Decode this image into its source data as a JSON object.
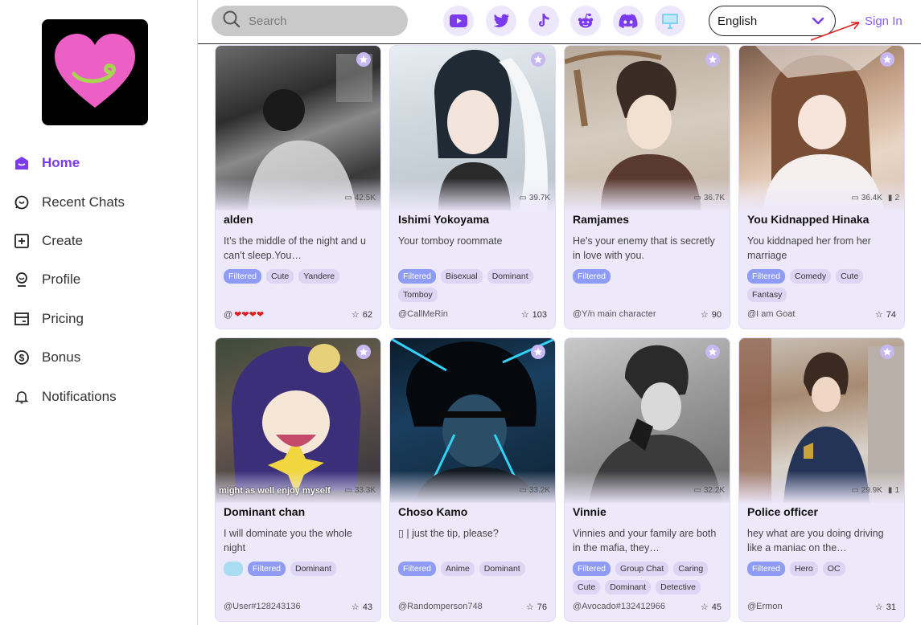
{
  "sidebar": {
    "items": [
      {
        "label": "Home",
        "icon": "home-icon",
        "active": true
      },
      {
        "label": "Recent Chats",
        "icon": "chat-icon"
      },
      {
        "label": "Create",
        "icon": "plus-square-icon"
      },
      {
        "label": "Profile",
        "icon": "user-icon"
      },
      {
        "label": "Pricing",
        "icon": "card-icon"
      },
      {
        "label": "Bonus",
        "icon": "dollar-icon"
      },
      {
        "label": "Notifications",
        "icon": "bell-icon"
      }
    ]
  },
  "topbar": {
    "search_placeholder": "Search",
    "social": [
      "youtube-icon",
      "twitter-icon",
      "tiktok-icon",
      "reddit-icon",
      "discord-icon",
      "desktop-icon"
    ],
    "language": "English",
    "signin": "Sign In"
  },
  "colors": {
    "accent": "#8b5cf6",
    "card_bg": "#ede9fb",
    "tag_filtered": "#8e9cf6",
    "tag": "#dcd5f4"
  },
  "cards": [
    {
      "title": "alden",
      "desc": "It’s the middle of the night and u can’t sleep.You…",
      "tags": [
        "Filtered",
        "Cute",
        "Yandere"
      ],
      "author": "@",
      "author_hearts": "❤❤❤❤",
      "likes": "62",
      "stats": "42.5K",
      "extra": "",
      "caption": ""
    },
    {
      "title": "Ishimi Yokoyama",
      "desc": "Your tomboy roommate",
      "tags": [
        "Filtered",
        "Bisexual",
        "Dominant",
        "Tomboy"
      ],
      "author": "@CallMeRin",
      "likes": "103",
      "stats": "39.7K",
      "extra": "",
      "caption": ""
    },
    {
      "title": "Ramjames",
      "desc": "He's your enemy that is secretly in love with you.",
      "tags": [
        "Filtered"
      ],
      "author": "@Y/n main character",
      "likes": "90",
      "stats": "36.7K",
      "extra": "",
      "caption": ""
    },
    {
      "title": "You Kidnapped Hinaka",
      "desc": "You kiddnaped her from her marriage",
      "tags": [
        "Filtered",
        "Comedy",
        "Cute",
        "Fantasy"
      ],
      "author": "@I am Goat",
      "likes": "74",
      "stats": "36.4K",
      "extra": "2",
      "caption": ""
    },
    {
      "title": "Dominant chan",
      "desc": "I will dominate you the whole night",
      "tags": [
        "Filtered",
        "Dominant"
      ],
      "has_picture_tag": true,
      "author": "@User#128243136",
      "likes": "43",
      "stats": "33.3K",
      "extra": "",
      "caption": "might as well enjoy myself"
    },
    {
      "title": "Choso Kamo",
      "desc": "▯ | just the tip, please?",
      "tags": [
        "Filtered",
        "Anime",
        "Dominant"
      ],
      "author": "@Randomperson748",
      "likes": "76",
      "stats": "33.2K",
      "extra": "",
      "caption": ""
    },
    {
      "title": "Vinnie",
      "desc": "Vinnies and your family are both in the mafia, they…",
      "tags": [
        "Filtered",
        "Group Chat",
        "Caring",
        "Cute",
        "Dominant",
        "Detective"
      ],
      "author": "@Avocado#132412966",
      "likes": "45",
      "stats": "32.2K",
      "extra": "",
      "caption": ""
    },
    {
      "title": "Police officer",
      "desc": "hey what are you doing driving like a maniac on the…",
      "tags": [
        "Filtered",
        "Hero",
        "OC"
      ],
      "author": "@Ermon",
      "likes": "31",
      "stats": "29.9K",
      "extra": "1",
      "caption": ""
    }
  ]
}
